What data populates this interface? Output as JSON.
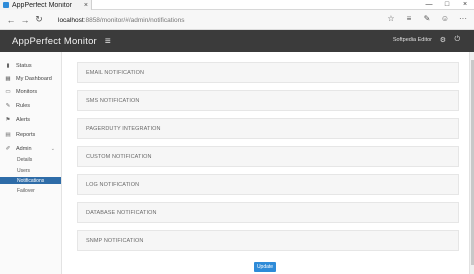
{
  "browser": {
    "tab_title": "AppPerfect Monitor",
    "tab_close": "×",
    "window_controls": [
      "—",
      "□",
      "×"
    ],
    "nav": {
      "back": "←",
      "forward": "→",
      "refresh": "↻"
    },
    "url_host": "localhost",
    "url_path": ":8858/monitor/#/admin/notifications",
    "addr_icons": [
      "☆",
      "≡",
      "✎",
      "☺",
      "···"
    ]
  },
  "header": {
    "title": "AppPerfect Monitor",
    "menu_icon": "≡",
    "user": "Softpedia Editor",
    "settings_icon": "⚙",
    "logout_icon": "⏻"
  },
  "sidebar": {
    "items": [
      {
        "label": "Status",
        "icon": "▮"
      },
      {
        "label": "My Dashboard",
        "icon": "▦"
      },
      {
        "label": "Monitors",
        "icon": "▭"
      },
      {
        "label": "Rules",
        "icon": "✎"
      },
      {
        "label": "Alerts",
        "icon": "⚑"
      },
      {
        "label": "Reports",
        "icon": "▤"
      },
      {
        "label": "Admin",
        "icon": "✐",
        "collapse": "⌄"
      }
    ],
    "sub_items": [
      {
        "label": "Details"
      },
      {
        "label": "Users"
      },
      {
        "label": "Notifications"
      },
      {
        "label": "Failover"
      }
    ]
  },
  "main": {
    "notifications": [
      "EMAIL NOTIFICATION",
      "SMS NOTIFICATION",
      "PAGERDUTY INTEGRATION",
      "CUSTOM NOTIFICATION",
      "LOG NOTIFICATION",
      "DATABASE NOTIFICATION",
      "SNMP NOTIFICATION"
    ],
    "update_label": "Update"
  }
}
